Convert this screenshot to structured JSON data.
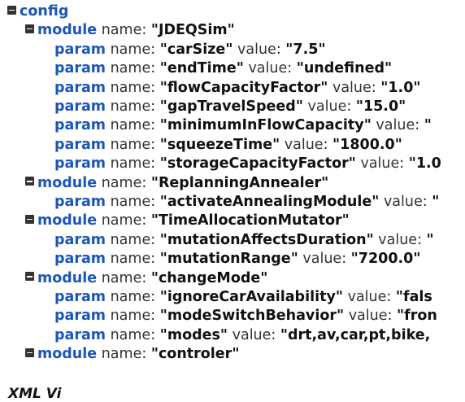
{
  "tree": [
    {
      "depth": 0,
      "toggle": true,
      "tag": "config",
      "attrs": []
    },
    {
      "depth": 1,
      "toggle": true,
      "tag": "module",
      "attrs": [
        {
          "key": "name",
          "value": "JDEQSim"
        }
      ]
    },
    {
      "depth": 2,
      "toggle": false,
      "tag": "param",
      "attrs": [
        {
          "key": "name",
          "value": "carSize"
        },
        {
          "key": "value",
          "value": "7.5"
        }
      ]
    },
    {
      "depth": 2,
      "toggle": false,
      "tag": "param",
      "attrs": [
        {
          "key": "name",
          "value": "endTime"
        },
        {
          "key": "value",
          "value": "undefined"
        }
      ]
    },
    {
      "depth": 2,
      "toggle": false,
      "tag": "param",
      "attrs": [
        {
          "key": "name",
          "value": "flowCapacityFactor"
        },
        {
          "key": "value",
          "value": "1.0"
        }
      ]
    },
    {
      "depth": 2,
      "toggle": false,
      "tag": "param",
      "attrs": [
        {
          "key": "name",
          "value": "gapTravelSpeed"
        },
        {
          "key": "value",
          "value": "15.0"
        }
      ]
    },
    {
      "depth": 2,
      "toggle": false,
      "tag": "param",
      "attrs": [
        {
          "key": "name",
          "value": "minimumInFlowCapacity"
        },
        {
          "key": "value",
          "value": ""
        }
      ]
    },
    {
      "depth": 2,
      "toggle": false,
      "tag": "param",
      "attrs": [
        {
          "key": "name",
          "value": "squeezeTime"
        },
        {
          "key": "value",
          "value": "1800.0"
        }
      ]
    },
    {
      "depth": 2,
      "toggle": false,
      "tag": "param",
      "attrs": [
        {
          "key": "name",
          "value": "storageCapacityFactor"
        },
        {
          "key": "value",
          "value": "1.0"
        }
      ]
    },
    {
      "depth": 1,
      "toggle": true,
      "tag": "module",
      "attrs": [
        {
          "key": "name",
          "value": "ReplanningAnnealer"
        }
      ]
    },
    {
      "depth": 2,
      "toggle": false,
      "tag": "param",
      "attrs": [
        {
          "key": "name",
          "value": "activateAnnealingModule"
        },
        {
          "key": "value",
          "value": ""
        }
      ]
    },
    {
      "depth": 1,
      "toggle": true,
      "tag": "module",
      "attrs": [
        {
          "key": "name",
          "value": "TimeAllocationMutator"
        }
      ]
    },
    {
      "depth": 2,
      "toggle": false,
      "tag": "param",
      "attrs": [
        {
          "key": "name",
          "value": "mutationAffectsDuration"
        },
        {
          "key": "value",
          "value": ""
        }
      ]
    },
    {
      "depth": 2,
      "toggle": false,
      "tag": "param",
      "attrs": [
        {
          "key": "name",
          "value": "mutationRange"
        },
        {
          "key": "value",
          "value": "7200.0"
        }
      ]
    },
    {
      "depth": 1,
      "toggle": true,
      "tag": "module",
      "attrs": [
        {
          "key": "name",
          "value": "changeMode"
        }
      ]
    },
    {
      "depth": 2,
      "toggle": false,
      "tag": "param",
      "attrs": [
        {
          "key": "name",
          "value": "ignoreCarAvailability"
        },
        {
          "key": "value",
          "value": "fals"
        }
      ]
    },
    {
      "depth": 2,
      "toggle": false,
      "tag": "param",
      "attrs": [
        {
          "key": "name",
          "value": "modeSwitchBehavior"
        },
        {
          "key": "value",
          "value": "fron"
        }
      ]
    },
    {
      "depth": 2,
      "toggle": false,
      "tag": "param",
      "attrs": [
        {
          "key": "name",
          "value": "modes"
        },
        {
          "key": "value",
          "value": "drt,av,car,pt,bike,"
        }
      ]
    },
    {
      "depth": 1,
      "toggle": true,
      "tag": "module",
      "attrs": [
        {
          "key": "name",
          "value": "controler"
        }
      ]
    }
  ],
  "footer_text": "XML Vi"
}
